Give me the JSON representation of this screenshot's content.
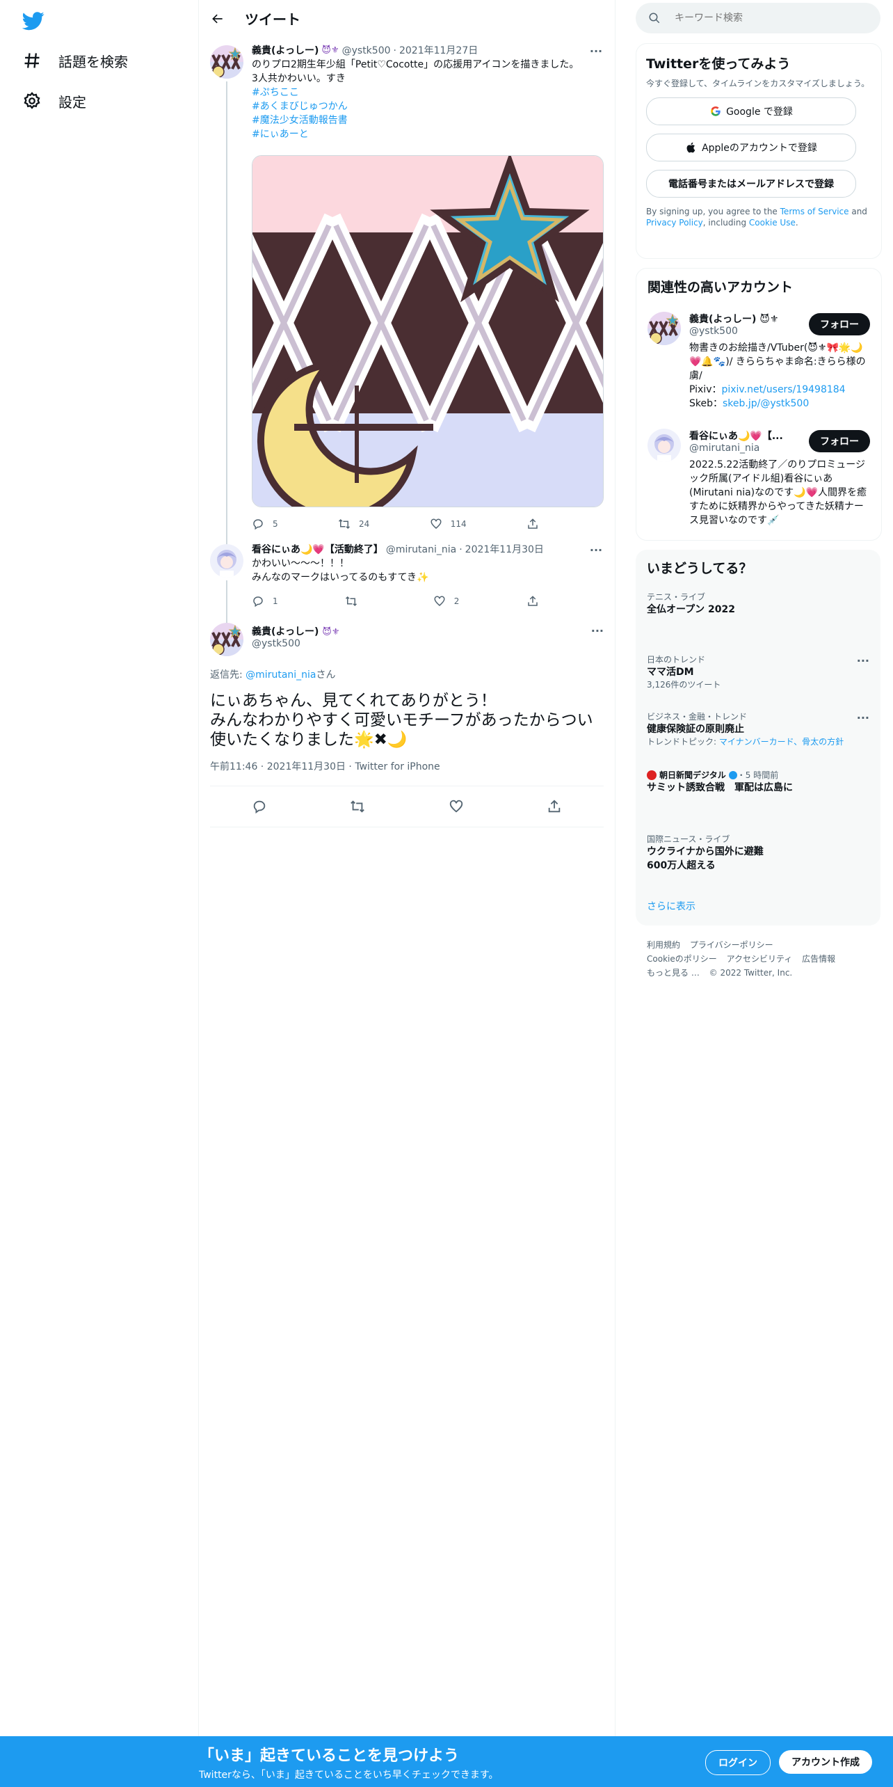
{
  "nav": {
    "explore_label": "話題を検索",
    "settings_label": "設定"
  },
  "header": {
    "title": "ツイート"
  },
  "tweet1": {
    "name": "義貴(よっしー)",
    "emoji": "😈⚜",
    "handle": "@ystk500",
    "date": "2021年11月27日",
    "text": "のりプロ2期生年少組「Petit♡Cocotte」の応援用アイコンを描きました。\n3人共かわいい。すき",
    "hashtags": [
      "#ぷちここ",
      "#あくまびじゅつかん",
      "#魔法少女活動報告書",
      "#にぃあーと"
    ],
    "replies": "5",
    "retweets": "24",
    "likes": "114"
  },
  "tweet2": {
    "name": "看谷にぃあ🌙💗【活動終了】",
    "handle": "@mirutani_nia",
    "date": "2021年11月30日",
    "text": "かわいい～～～！！！\nみんなのマークはいってるのもすてき✨",
    "replies": "1",
    "retweets": "",
    "likes": "2"
  },
  "focus": {
    "name": "義貴(よっしー)",
    "emoji": "😈⚜",
    "handle": "@ystk500",
    "reply_prefix": "返信先: ",
    "reply_handle": "@mirutani_nia",
    "reply_suffix": "さん",
    "text": "にぃあちゃん、見てくれてありがとう！\nみんなわかりやすく可愛いモチーフがあったからつい使いたくなりました🌟✖🌙",
    "time": "午前11:46",
    "date": "2021年11月30日",
    "client": "Twitter for iPhone"
  },
  "search": {
    "placeholder": "キーワード検索"
  },
  "signup": {
    "title": "Twitterを使ってみよう",
    "subtitle": "今すぐ登録して、タイムラインをカスタマイズしましょう。",
    "google": "Google で登録",
    "apple": "Appleのアカウントで登録",
    "phone": "電話番号またはメールアドレスで登録",
    "terms_prefix": "By signing up, you agree to the ",
    "terms_link": "Terms of Service",
    "terms_and": " and ",
    "privacy_link": "Privacy Policy",
    "terms_including": ", including ",
    "cookie_link": "Cookie Use",
    "terms_end": "."
  },
  "related": {
    "title": "関連性の高いアカウント",
    "follow_label": "フォロー",
    "accounts": [
      {
        "name": "義貴(よっしー) 😈⚜",
        "handle": "@ystk500",
        "bio": "物書きのお絵描き/VTuber(😈⚜🎀🌟🌙💗🔔🐾)/ きららちゃま命名:きらら様の虜/",
        "pixiv_label": "Pixiv：",
        "pixiv": "pixiv.net/users/19498184",
        "skeb_label": "Skeb：",
        "skeb": "skeb.jp/@ystk500"
      },
      {
        "name": "看谷にぃあ🌙💗【...",
        "handle": "@mirutani_nia",
        "bio": "2022.5.22活動終了／のりプロミュージック所属(アイドル組)看谷にぃあ(Mirutani nia)なのです🌙💗人間界を癒すために妖精界からやってきた妖精ナース見習いなのです💉"
      }
    ]
  },
  "trends": {
    "title": "いまどうしてる？",
    "items": [
      {
        "context": "テニス・ライブ",
        "title": "全仏オープン 2022",
        "count": ""
      },
      {
        "context": "日本のトレンド",
        "title": "ママ活DM",
        "count": "3,126件のツイート"
      },
      {
        "context": "ビジネス・金融・トレンド",
        "title": "健康保険証の原則廃止",
        "topic_prefix": "トレンドトピック: ",
        "topic": "マイナンバーカード、骨太の方針"
      },
      {
        "context": "朝日新聞デジタル",
        "time": "・5 時間前",
        "title": "サミット誘致合戦　軍配は広島に"
      },
      {
        "context": "国際ニュース・ライブ",
        "title": "ウクライナから国外に避難 600万人超える"
      }
    ],
    "show_more": "さらに表示"
  },
  "footer": {
    "links": [
      "利用規約",
      "プライバシーポリシー",
      "Cookieのポリシー",
      "アクセシビリティ",
      "広告情報",
      "もっと見る …"
    ],
    "copyright": "© 2022 Twitter, Inc."
  },
  "bottom_bar": {
    "title": "「いま」起きていることを見つけよう",
    "subtitle": "Twitterなら、「いま」起きていることをいち早くチェックできます。",
    "login": "ログイン",
    "register": "アカウント作成"
  },
  "colors": {
    "accent": "#1d9bf0",
    "text": "#0f1419",
    "muted": "#536471"
  }
}
